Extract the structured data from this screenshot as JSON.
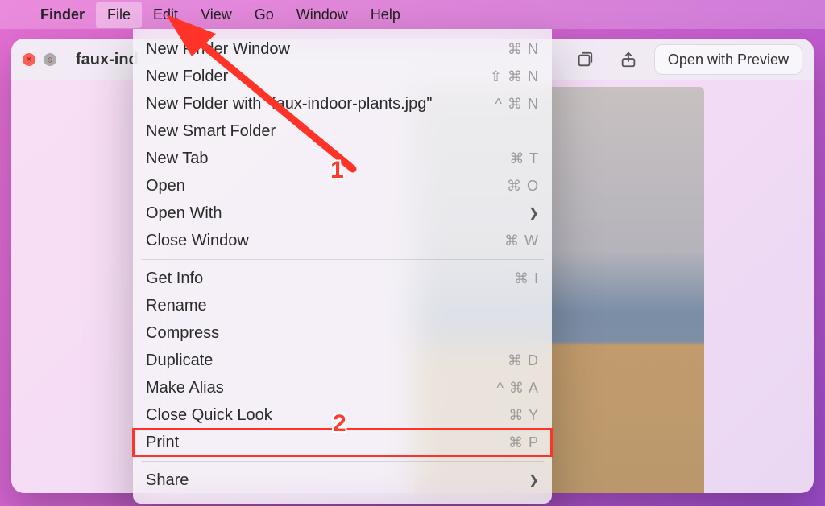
{
  "menubar": {
    "app_name": "Finder",
    "items": [
      "File",
      "Edit",
      "View",
      "Go",
      "Window",
      "Help"
    ],
    "open_index": 0
  },
  "window": {
    "title_truncated": "faux-ind",
    "open_with_label": "Open with Preview"
  },
  "dropdown": {
    "sections": [
      [
        {
          "label": "New Finder Window",
          "shortcut": "⌘ N"
        },
        {
          "label": "New Folder",
          "shortcut": "⇧ ⌘ N"
        },
        {
          "label": "New Folder with \"faux-indoor-plants.jpg\"",
          "shortcut": "^ ⌘ N"
        },
        {
          "label": "New Smart Folder",
          "shortcut": ""
        },
        {
          "label": "New Tab",
          "shortcut": "⌘ T"
        },
        {
          "label": "Open",
          "shortcut": "⌘ O"
        },
        {
          "label": "Open With",
          "shortcut": "",
          "submenu": true
        },
        {
          "label": "Close Window",
          "shortcut": "⌘ W"
        }
      ],
      [
        {
          "label": "Get Info",
          "shortcut": "⌘ I"
        },
        {
          "label": "Rename",
          "shortcut": ""
        },
        {
          "label": "Compress",
          "shortcut": ""
        },
        {
          "label": "Duplicate",
          "shortcut": "⌘ D"
        },
        {
          "label": "Make Alias",
          "shortcut": "^ ⌘ A"
        },
        {
          "label": "Close Quick Look",
          "shortcut": "⌘ Y"
        },
        {
          "label": "Print",
          "shortcut": "⌘ P",
          "highlight": true
        }
      ],
      [
        {
          "label": "Share",
          "shortcut": "",
          "submenu": true
        }
      ]
    ]
  },
  "annotations": {
    "badge1": "1",
    "badge2": "2"
  }
}
